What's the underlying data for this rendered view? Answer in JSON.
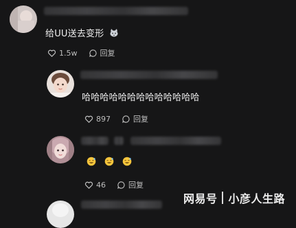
{
  "comments": [
    {
      "text": "给UU送去变形",
      "emoji_icon": "cat-emoji-icon",
      "likes": "1.5w",
      "reply_label": "回复"
    },
    {
      "text": "哈哈哈哈哈哈哈哈哈哈哈哈哈",
      "likes": "897",
      "reply_label": "回复"
    },
    {
      "emojis": [
        "grinning-sweat-emoji-icon",
        "grinning-sweat-emoji-icon",
        "grinning-sweat-emoji-icon"
      ],
      "likes": "46",
      "reply_label": "回复"
    }
  ],
  "watermark": {
    "brand": "网易号",
    "author": "小彦人生路"
  },
  "colors": {
    "background": "#161617",
    "text": "#f0f0f0",
    "meta": "#bdbdbd"
  }
}
